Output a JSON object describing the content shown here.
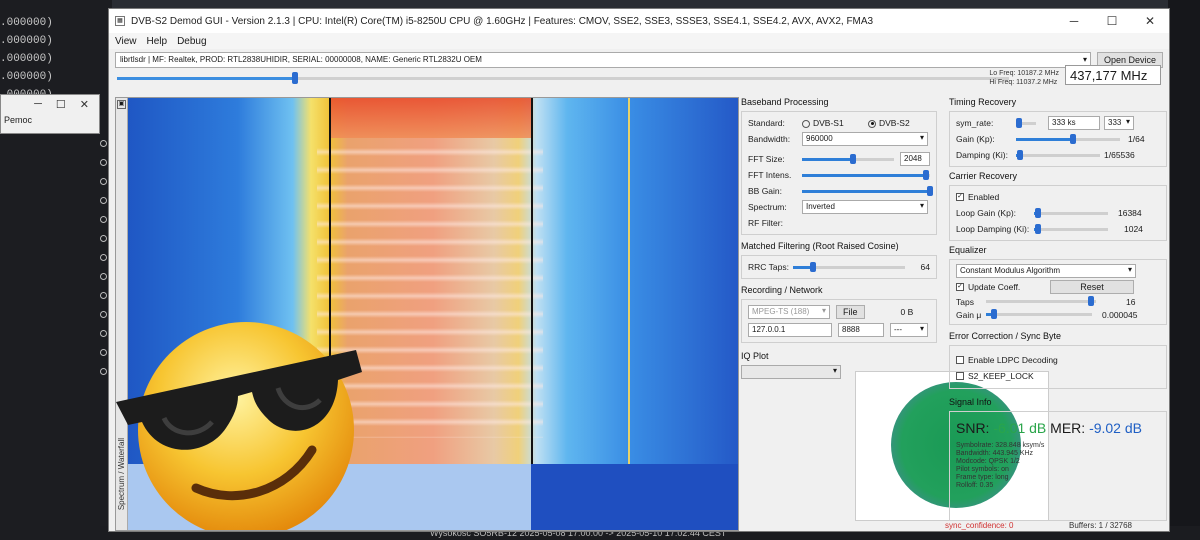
{
  "terminal": {
    "lines": [
      ".000000)",
      ".000000)",
      ".000000)",
      ".000000)",
      ".000000)"
    ]
  },
  "small_window": {
    "min": "─",
    "max": "☐",
    "close": "✕",
    "label": "Pemoc"
  },
  "taskbar_text": "Wysokość SO5RB-12 2025-05-08 17:00:00 -> 2025-05-10 17:02:44 CEST",
  "window": {
    "title": "DVB-S2 Demod GUI - Version 2.1.3 | CPU: Intel(R) Core(TM) i5-8250U CPU @ 1.60GHz | Features: CMOV, SSE2, SSE3, SSSE3, SSE4.1, SSE4.2, AVX, AVX2, FMA3",
    "min": "─",
    "max": "☐",
    "close": "✕"
  },
  "menu": [
    "View",
    "Help",
    "Debug"
  ],
  "device": {
    "selected": "librtlsdr | MF: Realtek, PROD: RTL2838UHIDIR, SERIAL: 00000008, NAME: Generic RTL2832U OEM",
    "open_label": "Open Device"
  },
  "frequency": {
    "lo": "Lo Freq: 10187.2 MHz",
    "hi": "Hi Freq: 11037.2 MHz",
    "value": "437,177 MHz",
    "slider_fraction": 0.2
  },
  "waterfall": {
    "side_label": "Spectrum / Waterfall"
  },
  "baseband": {
    "title": "Baseband Processing",
    "standard_label": "Standard:",
    "s1": "DVB-S1",
    "s2": "DVB-S2",
    "selected": "DVB-S2",
    "bandwidth_label": "Bandwidth:",
    "bandwidth": "960000",
    "fft_size_label": "FFT Size:",
    "fft_size": "2048",
    "fft_size_level": 0.55,
    "fft_intens_label": "FFT Intens.",
    "fft_intens_level": 0.97,
    "bb_gain_label": "BB Gain:",
    "bb_gain_level": 1.0,
    "spectrum_label": "Spectrum:",
    "spectrum": "Inverted",
    "rf_filter_label": "RF Filter:"
  },
  "matched": {
    "title": "Matched Filtering (Root Raised Cosine)",
    "rrc_label": "RRC Taps:",
    "rrc_value": "64",
    "rrc_level": 0.18
  },
  "recording": {
    "title": "Recording / Network",
    "format": "MPEG-TS (188)",
    "file_label": "File",
    "bytes": "0 B",
    "ip": "127.0.0.1",
    "port": "8888",
    "proto": "---"
  },
  "iq": {
    "title": "IQ Plot"
  },
  "timing": {
    "title": "Timing Recovery",
    "sym_rate_label": "sym_rate:",
    "sym_rate": "333 ks",
    "sym_rate_combo": "333",
    "gain_label": "Gain (Kp):",
    "gain_value": "1/64",
    "gain_level": 0.55,
    "damping_label": "Damping (Ki):",
    "damping_value": "1/65536",
    "damping_level": 0.05
  },
  "carrier": {
    "title": "Carrier Recovery",
    "enabled_label": "Enabled",
    "loop_gain_label": "Loop Gain (Kp):",
    "loop_gain_value": "16384",
    "loop_gain_level": 0.05,
    "loop_damp_label": "Loop Damping (Ki):",
    "loop_damp_value": "1024",
    "loop_damp_level": 0.05
  },
  "equalizer": {
    "title": "Equalizer",
    "algorithm": "Constant Modulus Algorithm",
    "update_label": "Update Coeff.",
    "reset_label": "Reset",
    "taps_label": "Taps",
    "taps_value": "16",
    "taps_level": 0.95,
    "gain_label": "Gain μ",
    "gain_value": "0.000045",
    "gain_level": 0.08
  },
  "fec": {
    "title": "Error Correction / Sync Byte",
    "ldpc_label": "Enable LDPC Decoding",
    "keep_lock_label": "S2_KEEP_LOCK"
  },
  "signal": {
    "title": "Signal Info",
    "snr_label": "SNR:",
    "snr": "-6.01 dB",
    "mer_label": "MER:",
    "mer": "-9.02 dB",
    "details": [
      "Symbolrate: 328.848 ksym/s",
      "Bandwidth: 443.945 KHz",
      "Modcode: QPSK 1/2",
      "Pilot symbols: on",
      "Frame type: long",
      "Rolloff: 0.35"
    ],
    "sync_confidence": "sync_confidence: 0",
    "buffers": "Buffers: 1 / 32768"
  },
  "colors": {
    "accent": "#2b6cd0",
    "snr_green": "#2aa54a",
    "mer_blue": "#1f5fc4"
  }
}
